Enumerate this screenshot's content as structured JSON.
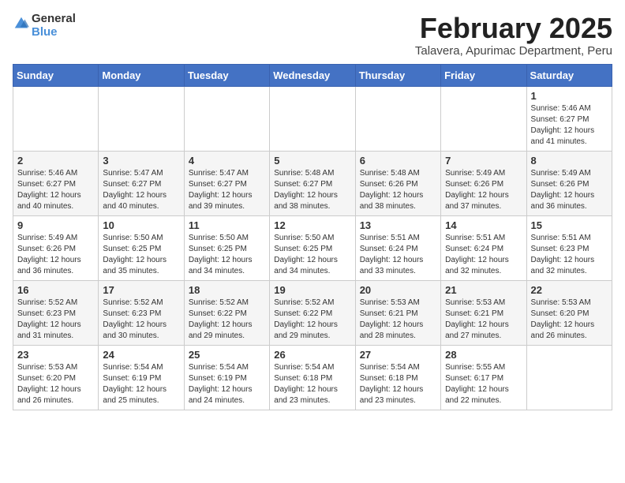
{
  "header": {
    "logo": {
      "general": "General",
      "blue": "Blue"
    },
    "title": "February 2025",
    "subtitle": "Talavera, Apurimac Department, Peru"
  },
  "calendar": {
    "weekdays": [
      "Sunday",
      "Monday",
      "Tuesday",
      "Wednesday",
      "Thursday",
      "Friday",
      "Saturday"
    ],
    "weeks": [
      [
        {
          "day": "",
          "info": ""
        },
        {
          "day": "",
          "info": ""
        },
        {
          "day": "",
          "info": ""
        },
        {
          "day": "",
          "info": ""
        },
        {
          "day": "",
          "info": ""
        },
        {
          "day": "",
          "info": ""
        },
        {
          "day": "1",
          "info": "Sunrise: 5:46 AM\nSunset: 6:27 PM\nDaylight: 12 hours\nand 41 minutes."
        }
      ],
      [
        {
          "day": "2",
          "info": "Sunrise: 5:46 AM\nSunset: 6:27 PM\nDaylight: 12 hours\nand 40 minutes."
        },
        {
          "day": "3",
          "info": "Sunrise: 5:47 AM\nSunset: 6:27 PM\nDaylight: 12 hours\nand 40 minutes."
        },
        {
          "day": "4",
          "info": "Sunrise: 5:47 AM\nSunset: 6:27 PM\nDaylight: 12 hours\nand 39 minutes."
        },
        {
          "day": "5",
          "info": "Sunrise: 5:48 AM\nSunset: 6:27 PM\nDaylight: 12 hours\nand 38 minutes."
        },
        {
          "day": "6",
          "info": "Sunrise: 5:48 AM\nSunset: 6:26 PM\nDaylight: 12 hours\nand 38 minutes."
        },
        {
          "day": "7",
          "info": "Sunrise: 5:49 AM\nSunset: 6:26 PM\nDaylight: 12 hours\nand 37 minutes."
        },
        {
          "day": "8",
          "info": "Sunrise: 5:49 AM\nSunset: 6:26 PM\nDaylight: 12 hours\nand 36 minutes."
        }
      ],
      [
        {
          "day": "9",
          "info": "Sunrise: 5:49 AM\nSunset: 6:26 PM\nDaylight: 12 hours\nand 36 minutes."
        },
        {
          "day": "10",
          "info": "Sunrise: 5:50 AM\nSunset: 6:25 PM\nDaylight: 12 hours\nand 35 minutes."
        },
        {
          "day": "11",
          "info": "Sunrise: 5:50 AM\nSunset: 6:25 PM\nDaylight: 12 hours\nand 34 minutes."
        },
        {
          "day": "12",
          "info": "Sunrise: 5:50 AM\nSunset: 6:25 PM\nDaylight: 12 hours\nand 34 minutes."
        },
        {
          "day": "13",
          "info": "Sunrise: 5:51 AM\nSunset: 6:24 PM\nDaylight: 12 hours\nand 33 minutes."
        },
        {
          "day": "14",
          "info": "Sunrise: 5:51 AM\nSunset: 6:24 PM\nDaylight: 12 hours\nand 32 minutes."
        },
        {
          "day": "15",
          "info": "Sunrise: 5:51 AM\nSunset: 6:23 PM\nDaylight: 12 hours\nand 32 minutes."
        }
      ],
      [
        {
          "day": "16",
          "info": "Sunrise: 5:52 AM\nSunset: 6:23 PM\nDaylight: 12 hours\nand 31 minutes."
        },
        {
          "day": "17",
          "info": "Sunrise: 5:52 AM\nSunset: 6:23 PM\nDaylight: 12 hours\nand 30 minutes."
        },
        {
          "day": "18",
          "info": "Sunrise: 5:52 AM\nSunset: 6:22 PM\nDaylight: 12 hours\nand 29 minutes."
        },
        {
          "day": "19",
          "info": "Sunrise: 5:52 AM\nSunset: 6:22 PM\nDaylight: 12 hours\nand 29 minutes."
        },
        {
          "day": "20",
          "info": "Sunrise: 5:53 AM\nSunset: 6:21 PM\nDaylight: 12 hours\nand 28 minutes."
        },
        {
          "day": "21",
          "info": "Sunrise: 5:53 AM\nSunset: 6:21 PM\nDaylight: 12 hours\nand 27 minutes."
        },
        {
          "day": "22",
          "info": "Sunrise: 5:53 AM\nSunset: 6:20 PM\nDaylight: 12 hours\nand 26 minutes."
        }
      ],
      [
        {
          "day": "23",
          "info": "Sunrise: 5:53 AM\nSunset: 6:20 PM\nDaylight: 12 hours\nand 26 minutes."
        },
        {
          "day": "24",
          "info": "Sunrise: 5:54 AM\nSunset: 6:19 PM\nDaylight: 12 hours\nand 25 minutes."
        },
        {
          "day": "25",
          "info": "Sunrise: 5:54 AM\nSunset: 6:19 PM\nDaylight: 12 hours\nand 24 minutes."
        },
        {
          "day": "26",
          "info": "Sunrise: 5:54 AM\nSunset: 6:18 PM\nDaylight: 12 hours\nand 23 minutes."
        },
        {
          "day": "27",
          "info": "Sunrise: 5:54 AM\nSunset: 6:18 PM\nDaylight: 12 hours\nand 23 minutes."
        },
        {
          "day": "28",
          "info": "Sunrise: 5:55 AM\nSunset: 6:17 PM\nDaylight: 12 hours\nand 22 minutes."
        },
        {
          "day": "",
          "info": ""
        }
      ]
    ]
  }
}
